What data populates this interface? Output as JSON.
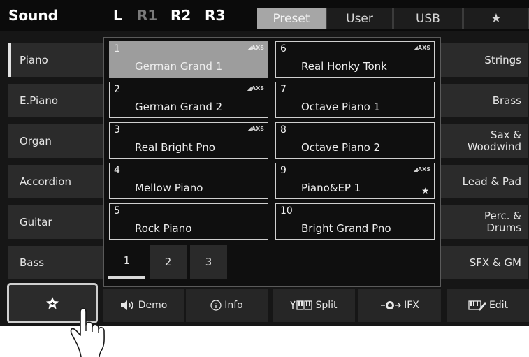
{
  "header": {
    "title": "Sound",
    "parts": [
      {
        "label": "L",
        "color": "#ffffff"
      },
      {
        "label": "R1",
        "color": "#7a7a7a"
      },
      {
        "label": "R2",
        "color": "#ffffff"
      },
      {
        "label": "R3",
        "color": "#ffffff"
      }
    ],
    "tabs": [
      {
        "label": "Preset",
        "active": true
      },
      {
        "label": "User",
        "active": false
      },
      {
        "label": "USB",
        "active": false
      },
      {
        "label": "★",
        "icon": "star-icon",
        "active": false
      }
    ]
  },
  "left_categories": [
    {
      "label": "Piano",
      "selected": true
    },
    {
      "label": "E.Piano"
    },
    {
      "label": "Organ"
    },
    {
      "label": "Accordion"
    },
    {
      "label": "Guitar"
    },
    {
      "label": "Bass"
    }
  ],
  "right_categories": [
    {
      "label": "Strings"
    },
    {
      "label": "Brass"
    },
    {
      "label": "Sax & Woodwind"
    },
    {
      "label": "Lead & Pad"
    },
    {
      "label": "Perc. & Drums"
    },
    {
      "label": "SFX & GM"
    }
  ],
  "voices": [
    {
      "number": "1",
      "name": "German Grand 1",
      "axs": "AXS",
      "selected": true
    },
    {
      "number": "2",
      "name": "German Grand 2",
      "axs": "AXS"
    },
    {
      "number": "3",
      "name": "Real Bright Pno",
      "axs": "AXS"
    },
    {
      "number": "4",
      "name": "Mellow Piano",
      "axs": ""
    },
    {
      "number": "5",
      "name": "Rock Piano",
      "axs": ""
    },
    {
      "number": "6",
      "name": "Real Honky Tonk",
      "axs": "AXS"
    },
    {
      "number": "7",
      "name": "Octave Piano 1",
      "axs": ""
    },
    {
      "number": "8",
      "name": "Octave Piano 2",
      "axs": ""
    },
    {
      "number": "9",
      "name": "Piano&EP 1",
      "axs": "AXS",
      "favorite": true
    },
    {
      "number": "10",
      "name": "Bright Grand Pno",
      "axs": ""
    }
  ],
  "pages": [
    {
      "label": "1",
      "selected": true
    },
    {
      "label": "2"
    },
    {
      "label": "3"
    }
  ],
  "bottom_bar": {
    "favorite_icon": "star-plus-icon",
    "demo": "Demo",
    "info": "Info",
    "split": "Split",
    "ifx": "IFX",
    "edit": "Edit"
  },
  "colors": {
    "background": "#161616",
    "selected_tile": "#9d9d9d",
    "button": "#2b2b2b"
  }
}
